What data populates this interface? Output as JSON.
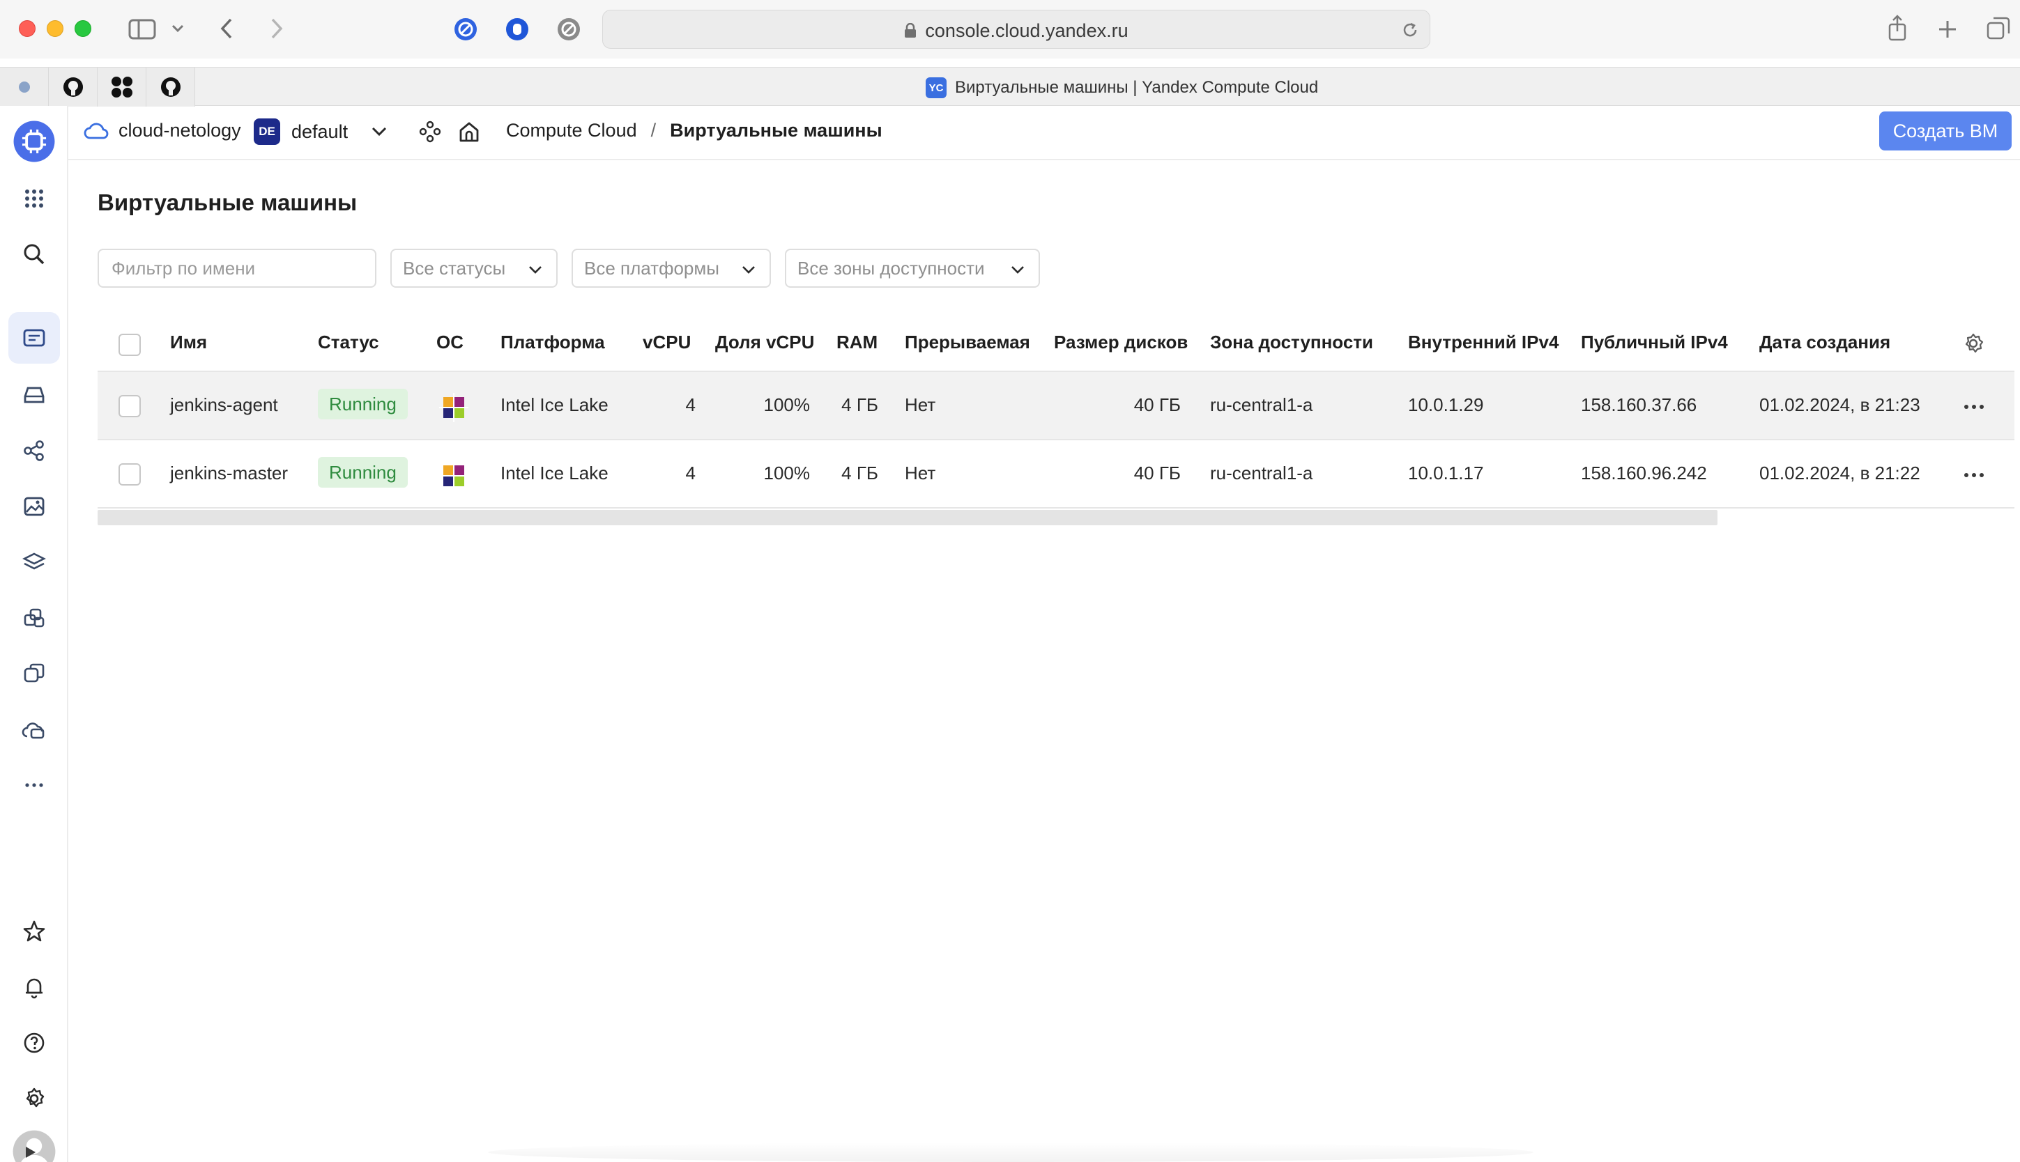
{
  "browser": {
    "url": "console.cloud.yandex.ru",
    "tab_title": "Виртуальные машины | Yandex Compute Cloud",
    "tab_badge": "YC"
  },
  "header": {
    "cloud_name": "cloud-netology",
    "folder_badge": "DE",
    "folder_name": "default",
    "breadcrumb_service": "Compute Cloud",
    "breadcrumb_separator": "/",
    "breadcrumb_current": "Виртуальные машины",
    "create_button": "Создать ВМ"
  },
  "page": {
    "title": "Виртуальные машины",
    "filter_placeholder": "Фильтр по имени",
    "status_select": "Все статусы",
    "platform_select": "Все платформы",
    "zone_select": "Все зоны доступности"
  },
  "table": {
    "columns": {
      "name": "Имя",
      "status": "Статус",
      "os": "ОС",
      "platform": "Платформа",
      "vcpu": "vCPU",
      "core_fraction": "Доля vCPU",
      "ram": "RAM",
      "preemptible": "Прерываемая",
      "disk_size": "Размер дисков",
      "zone": "Зона доступности",
      "internal_ip": "Внутренний IPv4",
      "public_ip": "Публичный IPv4",
      "created": "Дата создания"
    },
    "rows": [
      {
        "name": "jenkins-agent",
        "status": "Running",
        "os_icon": "centos-icon",
        "platform": "Intel Ice Lake",
        "vcpu": "4",
        "core_fraction": "100%",
        "ram": "4 ГБ",
        "preemptible": "Нет",
        "disk_size": "40 ГБ",
        "zone": "ru-central1-a",
        "internal_ip": "10.0.1.29",
        "public_ip": "158.160.37.66",
        "created": "01.02.2024, в 21:23"
      },
      {
        "name": "jenkins-master",
        "status": "Running",
        "os_icon": "centos-icon",
        "platform": "Intel Ice Lake",
        "vcpu": "4",
        "core_fraction": "100%",
        "ram": "4 ГБ",
        "preemptible": "Нет",
        "disk_size": "40 ГБ",
        "zone": "ru-central1-a",
        "internal_ip": "10.0.1.17",
        "public_ip": "158.160.96.242",
        "created": "01.02.2024, в 21:22"
      }
    ]
  },
  "colors": {
    "accent": "#5b86ef",
    "status_running_bg": "#dff3df",
    "status_running_text": "#2e8b3e"
  }
}
